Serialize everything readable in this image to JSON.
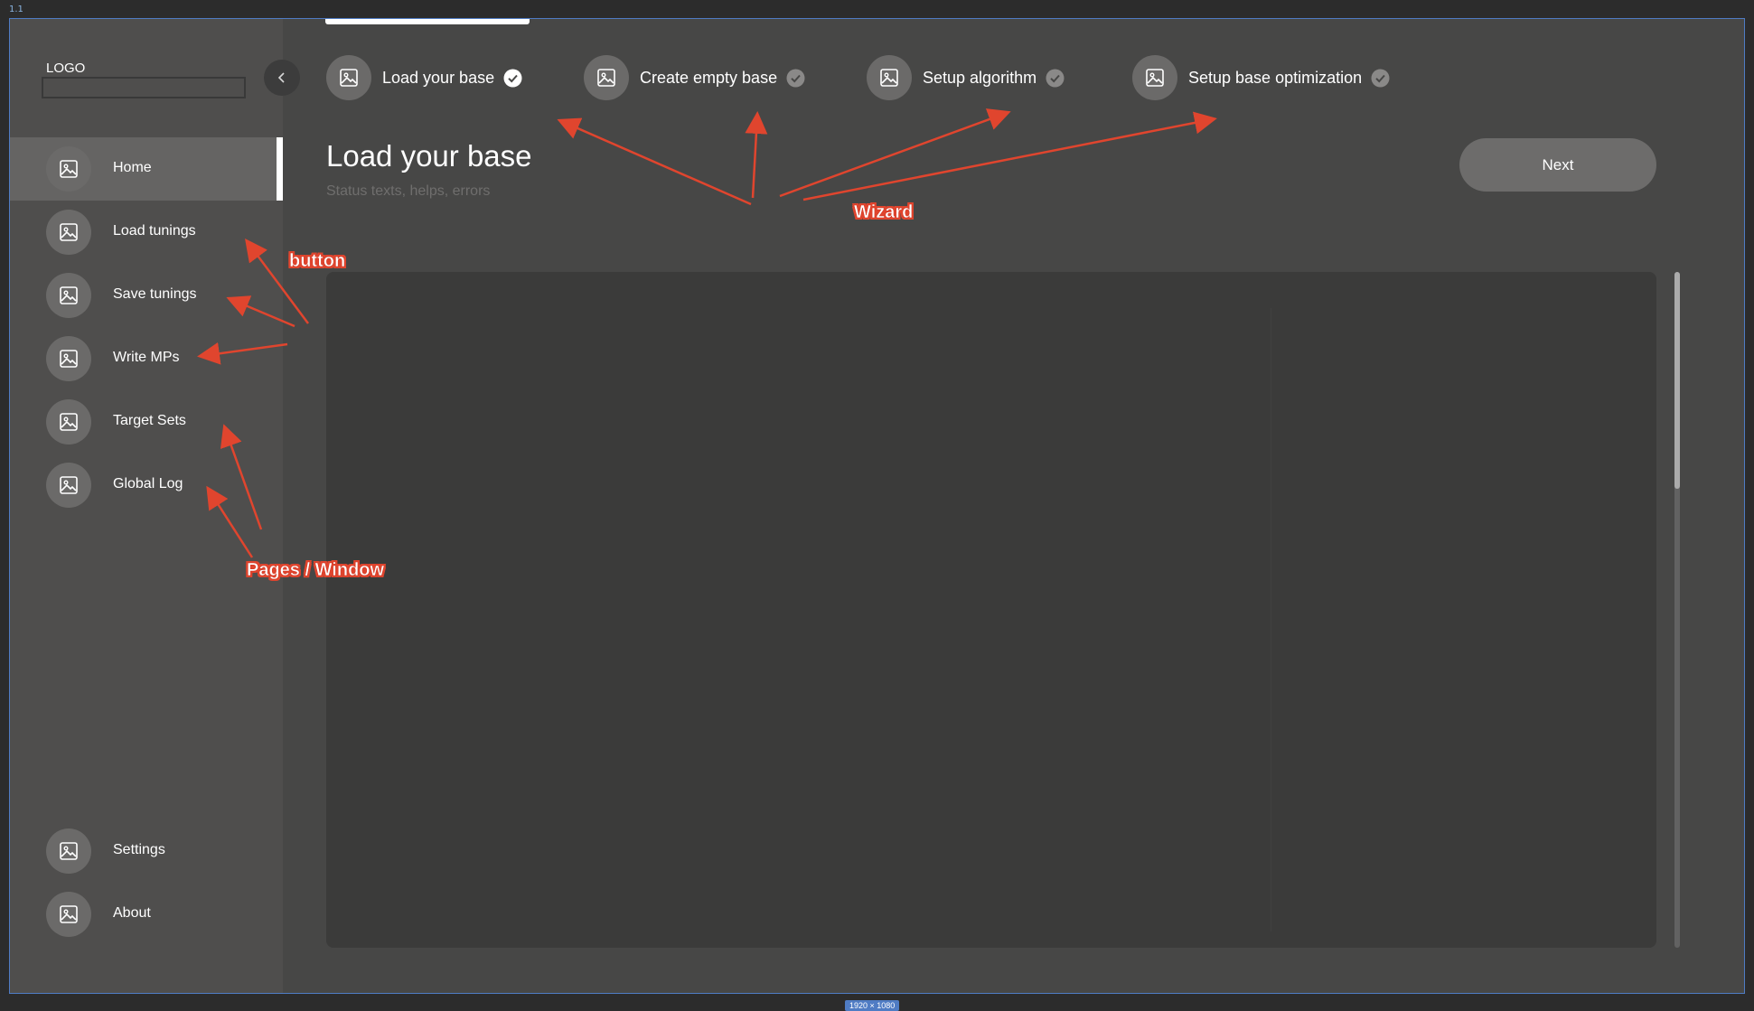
{
  "canvas": {
    "frame_label": "1.1",
    "size_badge": "1920 × 1080"
  },
  "sidebar": {
    "logo_label": "LOGO",
    "collapse_icon": "chevron-left-icon",
    "items": [
      {
        "label": "Home",
        "icon": "image-icon",
        "active": true
      },
      {
        "label": "Load tunings",
        "icon": "image-icon"
      },
      {
        "label": "Save tunings",
        "icon": "image-icon"
      },
      {
        "label": "Write MPs",
        "icon": "image-icon"
      },
      {
        "label": "Target Sets",
        "icon": "image-icon"
      },
      {
        "label": "Global Log",
        "icon": "image-icon"
      }
    ],
    "bottom_items": [
      {
        "label": "Settings",
        "icon": "image-icon"
      },
      {
        "label": "About",
        "icon": "image-icon"
      }
    ]
  },
  "wizard": {
    "steps": [
      {
        "label": "Load your base",
        "icon": "image-icon",
        "status": "complete-active"
      },
      {
        "label": "Create empty base",
        "icon": "image-icon",
        "status": "complete"
      },
      {
        "label": "Setup algorithm",
        "icon": "image-icon",
        "status": "complete"
      },
      {
        "label": "Setup base optimization",
        "icon": "image-icon",
        "status": "complete"
      }
    ]
  },
  "main": {
    "title": "Load your base",
    "subtitle": "Status texts, helps, errors",
    "next_label": "Next"
  },
  "annotations": {
    "button": "button",
    "wizard": "Wizard",
    "pages": "Pages / Window"
  },
  "colors": {
    "background": "#474746",
    "sidebar": "#4f4e4d",
    "panel": "#3b3b3a",
    "annotation": "#e0452e",
    "frame_border": "#4f7cc4"
  }
}
